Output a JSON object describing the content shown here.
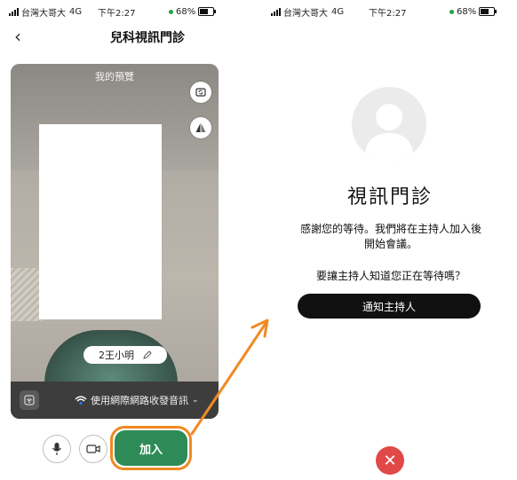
{
  "left": {
    "status": {
      "carrier": "台灣大哥大",
      "network": "4G",
      "time": "下午2:27",
      "battery": "68%"
    },
    "nav_title": "兒科視訊門診",
    "preview_label": "我的預覽",
    "name_tag": "2王小明",
    "audio_label": "使用網際網路收發音訊",
    "join_label": "加入"
  },
  "right": {
    "status": {
      "carrier": "台灣大哥大",
      "network": "4G",
      "time": "下午2:27",
      "battery": "68%"
    },
    "title": "視訊門診",
    "thanks_line1": "感謝您的等待。我們將在主持人加入後",
    "thanks_line2": "開始會議。",
    "question": "要讓主持人知道您正在等待嗎？",
    "notify_label": "通知主持人",
    "close_glyph": "✕"
  },
  "colors": {
    "join": "#2e8b57",
    "highlight": "#f08a24",
    "close": "#e14848",
    "notify": "#111111"
  },
  "icons": [
    "back-arrow-icon",
    "camera-switch-icon",
    "mirror-icon",
    "edit-icon",
    "wifi-audio-icon",
    "microphone-icon",
    "video-camera-icon",
    "close-icon",
    "avatar-icon"
  ]
}
